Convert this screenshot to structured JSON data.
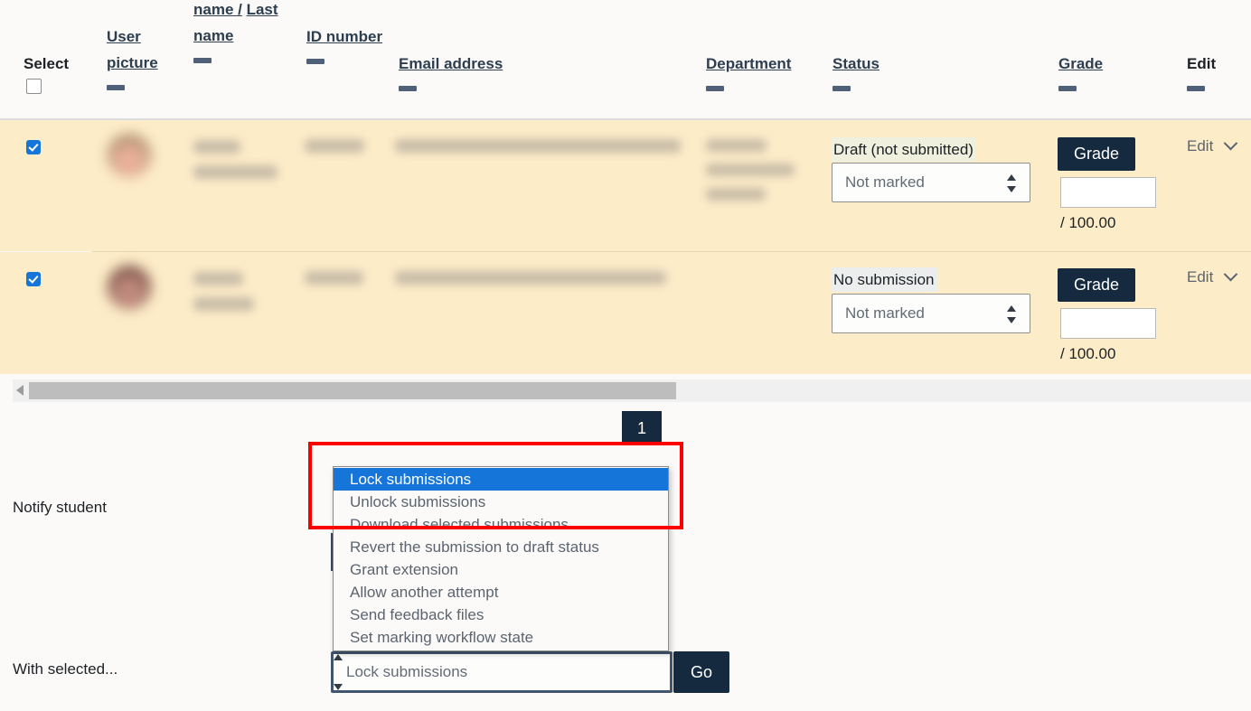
{
  "table": {
    "headers": {
      "select": "Select",
      "user_picture": "User picture",
      "fullname_first": "name /",
      "fullname_last": "Last name",
      "id_number": "ID number",
      "email": "Email address",
      "department": "Department",
      "status": "Status",
      "grade": "Grade",
      "edit": "Edit"
    },
    "rows": [
      {
        "selected": true,
        "status": "Draft (not submitted)",
        "marking_workflow": "Not marked",
        "grade_button": "Grade",
        "grade_value": "",
        "grade_max": "/ 100.00",
        "edit": "Edit"
      },
      {
        "selected": true,
        "status": "No submission",
        "marking_workflow": "Not marked",
        "grade_button": "Grade",
        "grade_value": "",
        "grade_max": "/ 100.00",
        "edit": "Edit"
      }
    ]
  },
  "pagination": {
    "current_page": "1"
  },
  "form": {
    "notify_label": "Notify student",
    "with_selected_label": "With selected...",
    "selected_action": "Lock submissions",
    "go_label": "Go"
  },
  "dropdown": {
    "options": [
      "Lock submissions",
      "Unlock submissions",
      "Download selected submissions",
      "Revert the submission to draft status",
      "Grant extension",
      "Allow another attempt",
      "Send feedback files",
      "Set marking workflow state"
    ],
    "selected_index": 0
  },
  "colors": {
    "row_highlight": "#fdecc8",
    "accent_navy": "#152a3f",
    "selection_blue": "#1675d8",
    "annotation_red": "#fc0000",
    "status_draft_bg": "#eff0dd",
    "status_nosub_bg": "#eceeee"
  }
}
